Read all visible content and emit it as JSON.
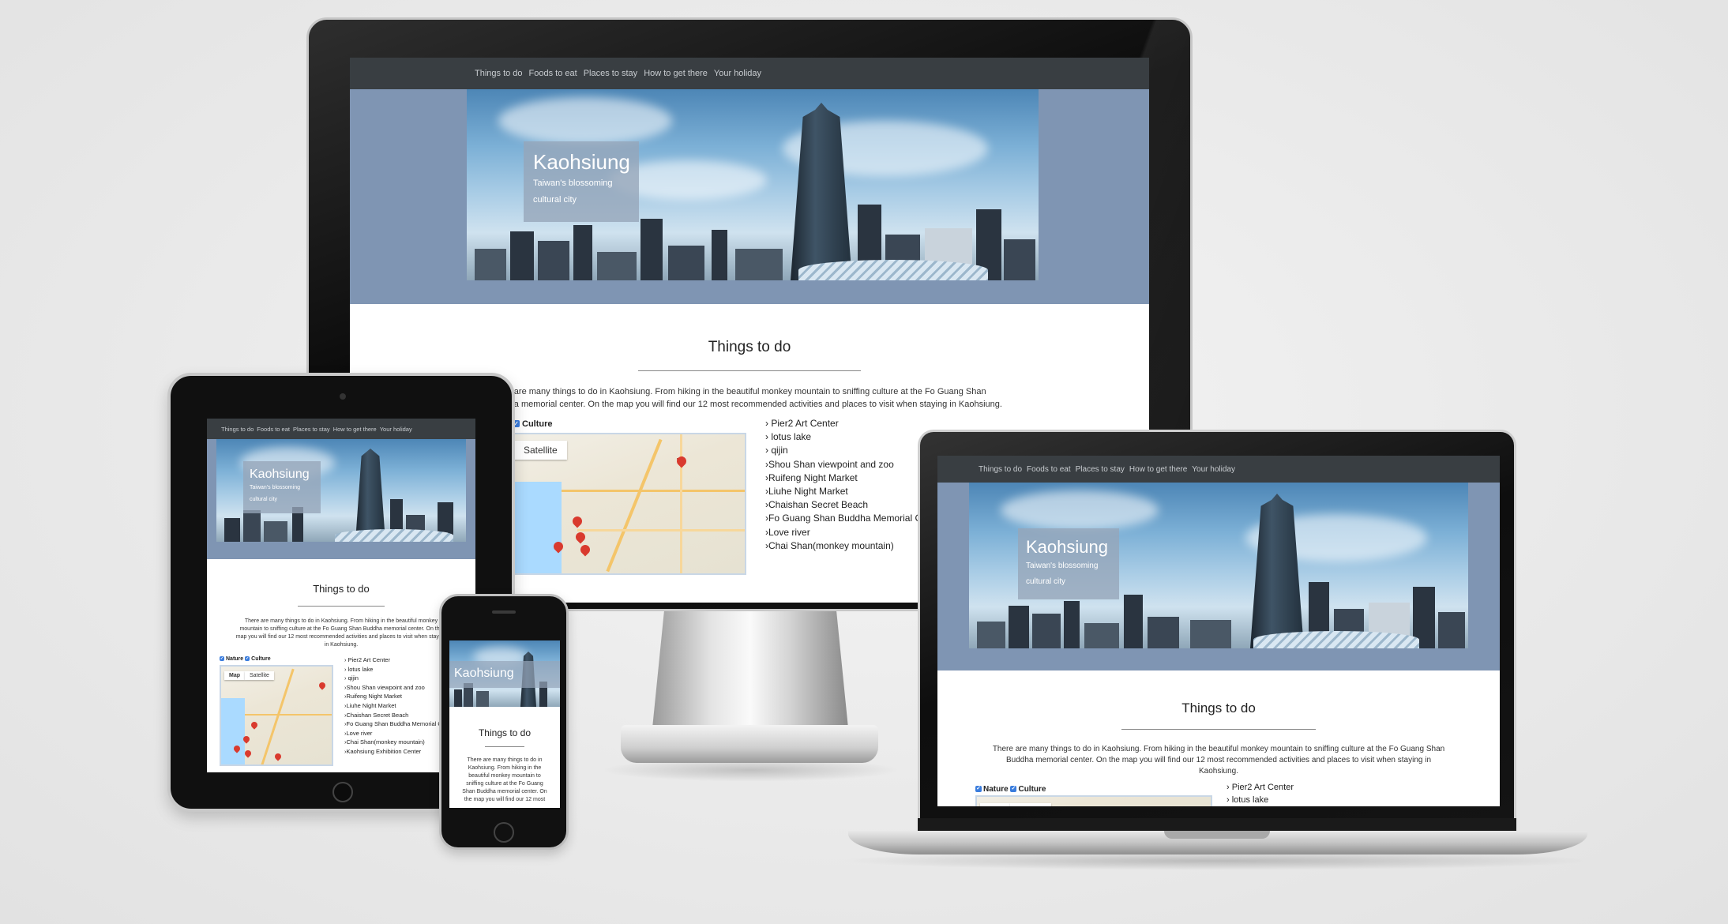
{
  "site": {
    "nav": [
      "Things to do",
      "Foods to eat",
      "Places to stay",
      "How to get there",
      "Your holiday"
    ],
    "hero_title": "Kaohsiung",
    "hero_subtitle_1": "Taiwan's blossoming",
    "hero_subtitle_2": "cultural city",
    "section_title": "Things to do",
    "intro": "There are many things to do in Kaohsiung. From hiking in the beautiful monkey mountain to sniffing culture at the Fo Guang Shan Buddha memorial center. On the map you will find our 12 most recommended activities and places to visit when staying in Kaohsiung.",
    "filters": {
      "nature": "Nature",
      "culture": "Culture"
    },
    "map_tabs": {
      "map": "Map",
      "satellite": "Satellite"
    },
    "places": [
      "Pier2 Art Center",
      "lotus lake",
      "qijin",
      "Shou Shan viewpoint and zoo",
      "Ruifeng Night Market",
      "Liuhe Night Market",
      "Chaishan Secret Beach",
      "Fo Guang Shan Buddha Memorial Center",
      "Love river",
      "Chai Shan(monkey mountain)",
      "Kaohsiung Exhibition Center"
    ]
  },
  "devices": [
    "desktop-monitor",
    "tablet",
    "laptop",
    "phone"
  ],
  "colors": {
    "background": "#ececec",
    "nav": "#393e42",
    "hero": "#7f95b3",
    "title_box": "#96a5b9",
    "marker": "#d93a2e",
    "checkbox": "#3b7ddd"
  }
}
